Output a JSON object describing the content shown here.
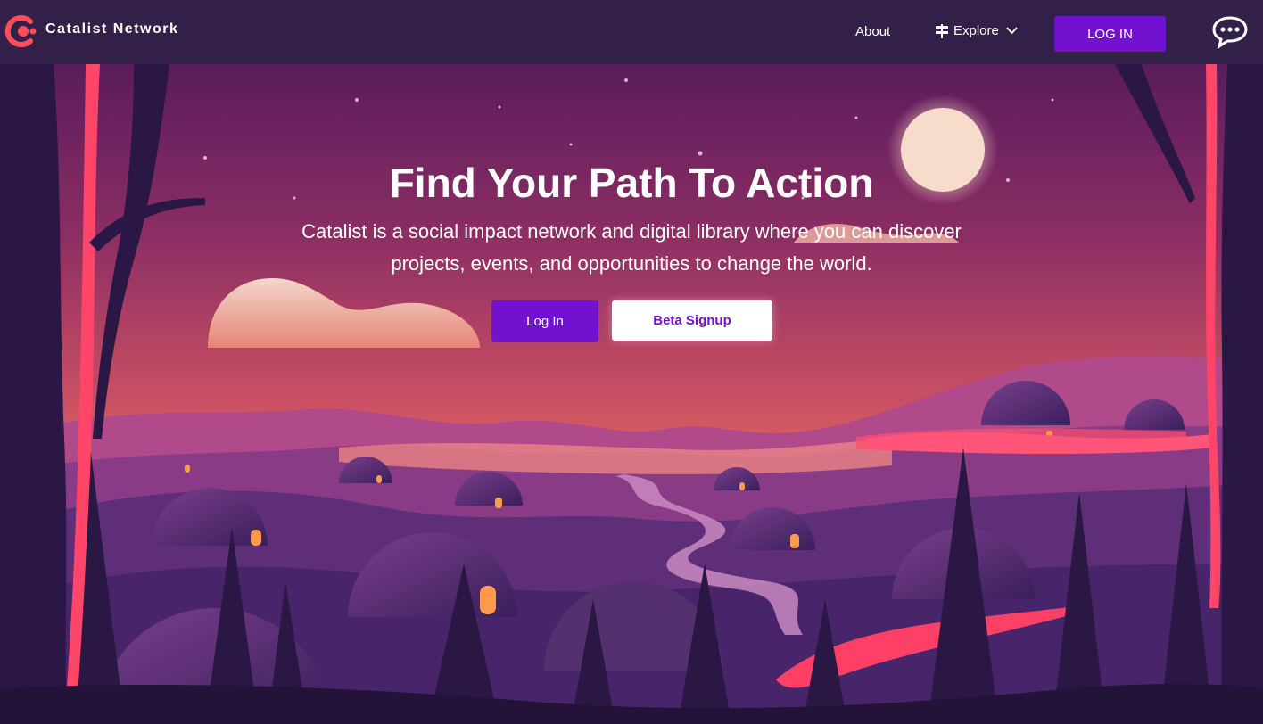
{
  "nav": {
    "brand": "Catalist Network",
    "about": "About",
    "explore": "Explore",
    "login": "LOG IN",
    "icons": {
      "logo": "catalist-logo",
      "explore": "signpost-icon",
      "chevron": "chevron-down-icon",
      "chat": "chat-bubble-icon"
    }
  },
  "hero": {
    "title": "Find Your Path To Action",
    "subtitle": "Catalist is a social impact network and digital library where you can discover projects, events, and opportunities to change the world.",
    "login_button": "Log In",
    "beta_button": "Beta Signup"
  },
  "colors": {
    "accent": "#7212d0",
    "nav_bg": "#332048",
    "logo": "#ff4d5a"
  }
}
